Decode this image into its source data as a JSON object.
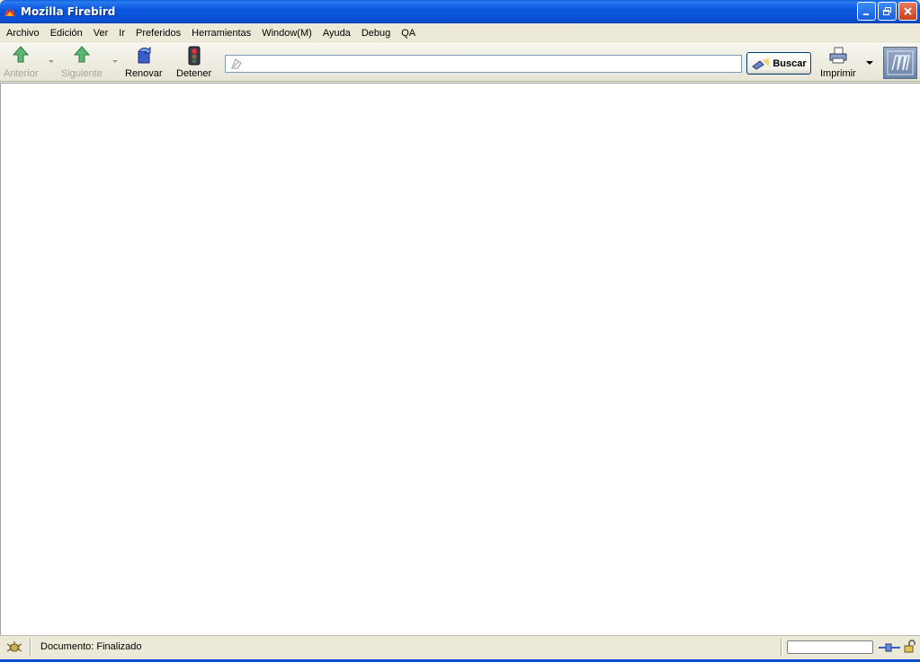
{
  "window": {
    "title": "Mozilla Firebird",
    "controls": [
      "minimize",
      "restore",
      "close"
    ]
  },
  "menubar": {
    "items": [
      "Archivo",
      "Edición",
      "Ver",
      "Ir",
      "Preferidos",
      "Herramientas",
      "Window(M)",
      "Ayuda",
      "Debug",
      "QA"
    ]
  },
  "toolbar": {
    "back_label": "Anterior",
    "forward_label": "Siguiente",
    "reload_label": "Renovar",
    "stop_label": "Detener",
    "url_value": "",
    "search_label": "Buscar",
    "print_label": "Imprimir"
  },
  "statusbar": {
    "text": "Documento: Finalizado"
  },
  "colors": {
    "titlebar": "#0a58e0",
    "chrome": "#ece9d8",
    "content": "#ffffff"
  }
}
